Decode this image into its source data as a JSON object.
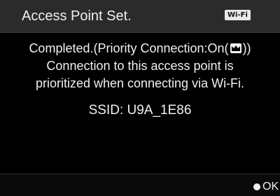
{
  "header": {
    "title": "Access Point Set.",
    "wifi_badge": "Wi-Fi"
  },
  "message": {
    "line1_prefix": "Completed.(Priority Connection:On(",
    "line1_suffix": "))",
    "line2": "Connection to this access point is",
    "line3": "prioritized when connecting via Wi-Fi.",
    "priority_icon": "crown-icon"
  },
  "ssid": {
    "text": "SSID: U9A_1E86"
  },
  "footer": {
    "ok_label": "OK",
    "ok_icon": "filled-circle-icon"
  },
  "colors": {
    "background": "#000000",
    "header_bg": "#2b2b2b",
    "text": "#f0f0f0",
    "badge_bg": "#e8e8e8"
  }
}
